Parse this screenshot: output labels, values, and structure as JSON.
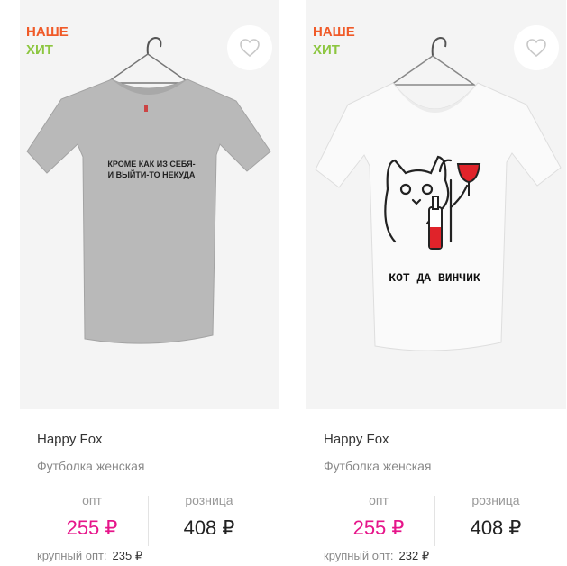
{
  "products": [
    {
      "badges": [
        "НАШЕ",
        "ХИТ"
      ],
      "print_text": [
        "КРОМЕ КАК ИЗ СЕБЯ-",
        "И ВЫЙТИ-ТО НЕКУДА"
      ],
      "brand": "Happy Fox",
      "title": "Футболка женская",
      "opt_label": "опт",
      "opt_price": "255 ₽",
      "retail_label": "розница",
      "retail_price": "408 ₽",
      "bulk_label": "крупный опт:",
      "bulk_price": "235 ₽",
      "shirt_color": "#b9b9b9"
    },
    {
      "badges": [
        "НАШЕ",
        "ХИТ"
      ],
      "print_text": [
        "КОТ ДА ВИНЧИК"
      ],
      "brand": "Happy Fox",
      "title": "Футболка женская",
      "opt_label": "опт",
      "opt_price": "255 ₽",
      "retail_label": "розница",
      "retail_price": "408 ₽",
      "bulk_label": "крупный опт:",
      "bulk_price": "232 ₽",
      "shirt_color": "#fafafa"
    }
  ],
  "colors": {
    "badge_primary": "#f05a28",
    "badge_secondary": "#8cc63f",
    "price_accent": "#e6158a",
    "heart_outline": "#c8c8c8"
  },
  "icons": {
    "favorite": "heart-outline-icon",
    "hanger": "hanger-icon"
  }
}
